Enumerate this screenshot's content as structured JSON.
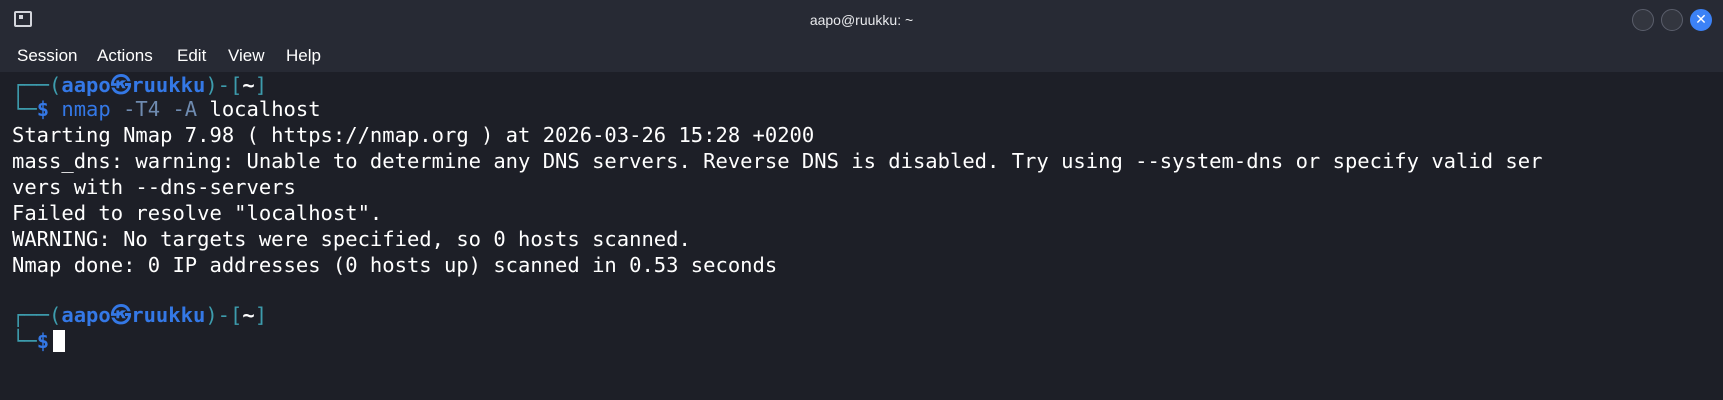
{
  "window": {
    "title": "aapo@ruukku: ~",
    "close_glyph": "✕"
  },
  "menu": [
    "Session",
    "Actions",
    "Edit",
    "View",
    "Help"
  ],
  "prompt": {
    "frame_top_left": "┌──(",
    "user": "aapo",
    "at_symbol": "㉿",
    "host": "ruukku",
    "bracket_mid": ")-[",
    "dir": "~",
    "bracket_end": "]",
    "frame_bottom": "└─",
    "dollar": "$"
  },
  "command": {
    "name": "nmap",
    "args": "-T4 -A",
    "target": "localhost"
  },
  "output": [
    "Starting Nmap 7.98 ( https://nmap.org ) at 2026-03-26 15:28 +0200",
    "mass_dns: warning: Unable to determine any DNS servers. Reverse DNS is disabled. Try using --system-dns or specify valid ser",
    "vers with --dns-servers",
    "Failed to resolve \"localhost\".",
    "WARNING: No targets were specified, so 0 hosts scanned.",
    "Nmap done: 0 IP addresses (0 hosts up) scanned in 0.53 seconds"
  ],
  "colors": {
    "background": "#1d1f27",
    "titlebar": "#272a34",
    "prompt_frame": "#3d9cad",
    "prompt_user": "#3478e6",
    "close_button": "#3c82f6"
  }
}
